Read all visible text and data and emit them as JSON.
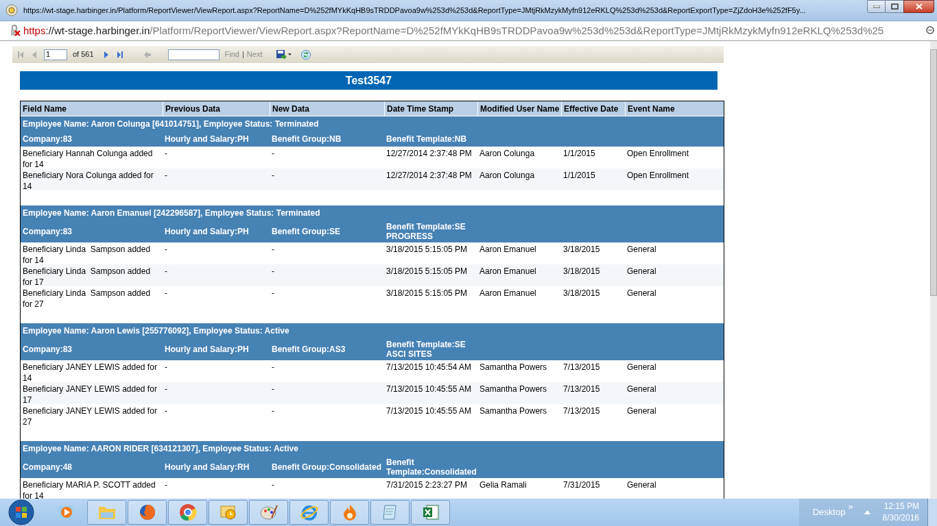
{
  "window": {
    "title": "https://wt-stage.harbinger.in/Platform/ReportViewer/ViewReport.aspx?ReportName=D%252fMYkKqHB9sTRDDPavoa9w%253d%253d&ReportType=JMtjRkMzykMyfn912eRKLQ%253d%253d&ReportExportType=ZjZdoH3e%252fF5y..."
  },
  "address_bar": {
    "scheme": "https",
    "host": "://wt-stage.harbinger.in",
    "path": "/Platform/ReportViewer/ViewReport.aspx?ReportName=D%252fMYkKqHB9sTRDDPavoa9w%253d%253d&ReportType=JMtjRkMzykMyfn912eRKLQ%253d%25"
  },
  "toolbar": {
    "nav": [
      {
        "kind": "first",
        "disabled": true
      },
      {
        "kind": "prev",
        "disabled": true
      }
    ],
    "page": "1",
    "page_count": "of 561",
    "nav2": [
      {
        "kind": "next",
        "disabled": false
      },
      {
        "kind": "last",
        "disabled": false
      },
      {
        "kind": "back",
        "disabled": true
      }
    ],
    "find_link": {
      "label": "Find",
      "disabled": true
    },
    "separator": "|",
    "next_link": {
      "label": "Next",
      "disabled": true
    }
  },
  "report": {
    "title": "Test3547",
    "columns": [
      "Field Name",
      "Previous Data",
      "New Data",
      "Date Time Stamp",
      "Modified User Name",
      "Effective Date",
      "Event Name"
    ],
    "groups": [
      {
        "employee": "Employee Name: Aaron Colunga [641014751], Employee Status: Terminated",
        "fields": [
          "Company:83",
          "Hourly and Salary:PH",
          "Benefit Group:NB",
          "Benefit Template:NB"
        ],
        "rows": [
          [
            "Beneficiary Hannah Colunga added for 14",
            "-",
            "-",
            "12/27/2014 2:37:48 PM",
            "Aaron Colunga",
            "1/1/2015",
            "Open Enrollment"
          ],
          [
            "Beneficiary Nora Colunga added for 14",
            "-",
            "-",
            "12/27/2014 2:37:48 PM",
            "Aaron Colunga",
            "1/1/2015",
            "Open Enrollment"
          ]
        ]
      },
      {
        "employee": "Employee Name: Aaron Emanuel [242296587], Employee Status: Terminated",
        "fields": [
          "Company:83",
          "Hourly and Salary:PH",
          "Benefit Group:SE",
          "Benefit Template:SE PROGRESS"
        ],
        "rows": [
          [
            "Beneficiary Linda  Sampson added for 14",
            "-",
            "-",
            "3/18/2015 5:15:05 PM",
            "Aaron Emanuel",
            "3/18/2015",
            "General"
          ],
          [
            "Beneficiary Linda  Sampson added for 17",
            "-",
            "-",
            "3/18/2015 5:15:05 PM",
            "Aaron Emanuel",
            "3/18/2015",
            "General"
          ],
          [
            "Beneficiary Linda  Sampson added for 27",
            "-",
            "-",
            "3/18/2015 5:15:05 PM",
            "Aaron Emanuel",
            "3/18/2015",
            "General"
          ]
        ]
      },
      {
        "employee": "Employee Name: Aaron Lewis [255776092], Employee Status: Active",
        "fields": [
          "Company:83",
          "Hourly and Salary:PH",
          "Benefit Group:AS3",
          "Benefit Template:SE ASCI SITES"
        ],
        "rows": [
          [
            "Beneficiary JANEY LEWIS added for 14",
            "-",
            "-",
            "7/13/2015 10:45:54 AM",
            "Samantha Powers",
            "7/13/2015",
            "General"
          ],
          [
            "Beneficiary JANEY LEWIS added for 17",
            "-",
            "-",
            "7/13/2015 10:45:55 AM",
            "Samantha Powers",
            "7/13/2015",
            "General"
          ],
          [
            "Beneficiary JANEY LEWIS added for 27",
            "-",
            "-",
            "7/13/2015 10:45:55 AM",
            "Samantha Powers",
            "7/13/2015",
            "General"
          ]
        ]
      },
      {
        "employee": "Employee Name: AARON RIDER [634121307], Employee Status: Active",
        "fields": [
          "Company:48",
          "Hourly and Salary:RH",
          "Benefit Group:Consolidated",
          "Benefit Template:Consolidated"
        ],
        "rows": [
          [
            "Beneficiary MARIA P. SCOTT added for 14",
            "-",
            "-",
            "7/31/2015 2:23:27 PM",
            "Gelia Ramali",
            "7/31/2015",
            "General"
          ]
        ]
      }
    ]
  },
  "taskbar": {
    "apps": [
      {
        "kind": "media"
      },
      {
        "kind": "folder"
      },
      {
        "kind": "firefox"
      },
      {
        "kind": "chrome"
      },
      {
        "kind": "outlook"
      },
      {
        "kind": "paint"
      },
      {
        "kind": "ie"
      },
      {
        "kind": "flame"
      },
      {
        "kind": "notepad"
      },
      {
        "kind": "excel"
      }
    ],
    "toolbar_label": "Desktop",
    "overflow": "»",
    "time": "12:15 PM",
    "date": "8/30/2016"
  }
}
